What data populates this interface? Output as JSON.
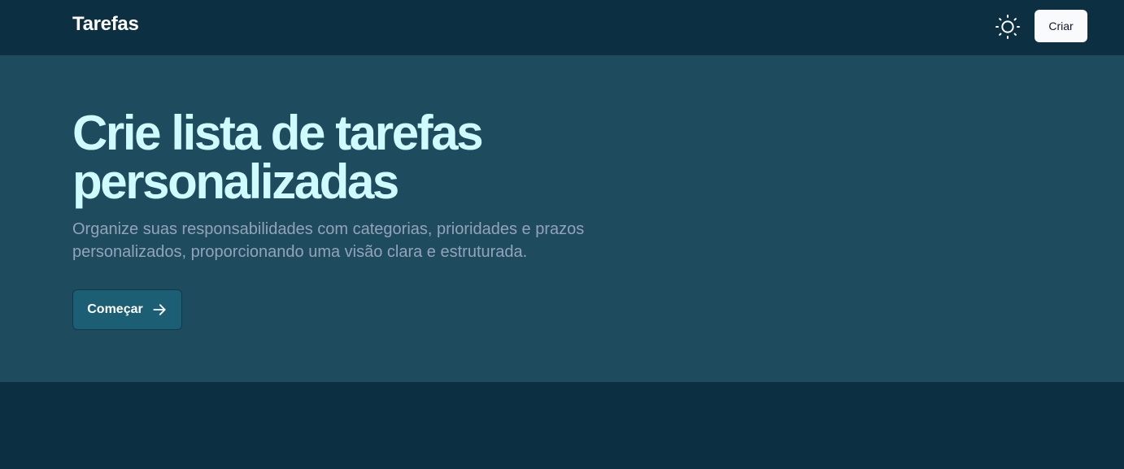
{
  "header": {
    "brand": "Tarefas",
    "theme_toggle_icon": "sun-icon",
    "create_label": "Criar"
  },
  "hero": {
    "title_line1": "Crie lista de tarefas",
    "title_line2": "personalizadas",
    "subtitle_line1": "Organize suas responsabilidades com categorias, prioridades e prazos",
    "subtitle_line2": "personalizados, proporcionando uma visão clara e estruturada.",
    "start_label": "Começar",
    "start_icon": "arrow-right-icon"
  },
  "colors": {
    "navbar_bg": "#0c2f41",
    "hero_bg": "#1e4c5e",
    "title": "#cffafe",
    "subtitle": "#94a3b8",
    "primary_button": "#1c5f74",
    "create_button": "#f8fafc"
  }
}
